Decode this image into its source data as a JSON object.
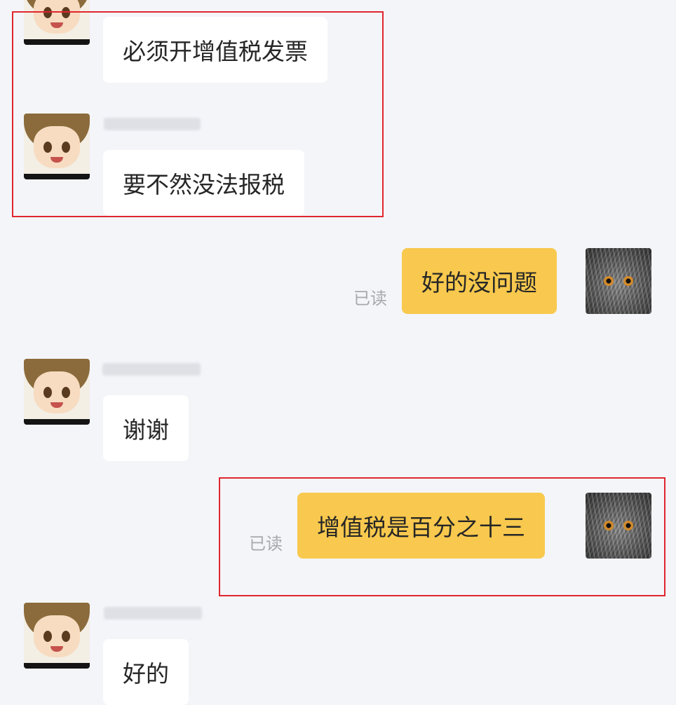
{
  "chat": {
    "messages": [
      {
        "side": "in",
        "text": "必须开增值税发票"
      },
      {
        "side": "in",
        "text": "要不然没法报税"
      },
      {
        "side": "out",
        "text": "好的没问题",
        "status": "已读"
      },
      {
        "side": "in",
        "text": "谢谢"
      },
      {
        "side": "out",
        "text": "增值税是百分之十三",
        "status": "已读"
      },
      {
        "side": "in",
        "text": "好的"
      }
    ]
  },
  "colors": {
    "background": "#f4f5f9",
    "incoming_bubble": "#ffffff",
    "outgoing_bubble": "#f8c94e",
    "highlight_box": "#e0262e",
    "read_status": "#a8a9ad"
  },
  "icons": {
    "contact_avatar": "anime-boy-avatar-icon",
    "self_avatar": "owl-avatar-icon"
  }
}
